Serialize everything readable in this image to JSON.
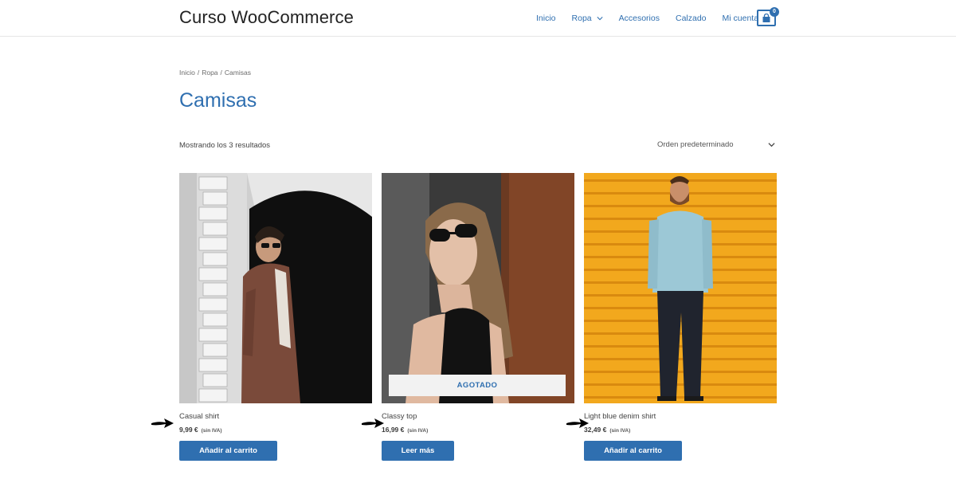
{
  "header": {
    "site_title": "Curso WooCommerce",
    "nav": [
      {
        "label": "Inicio"
      },
      {
        "label": "Ropa",
        "has_dropdown": true
      },
      {
        "label": "Accesorios"
      },
      {
        "label": "Calzado"
      },
      {
        "label": "Mi cuenta"
      }
    ],
    "cart_count": "0",
    "cart_icon": "shopping-bag-icon"
  },
  "breadcrumb": [
    "Inicio",
    "/",
    "Ropa",
    "/",
    "Camisas"
  ],
  "page_title": "Camisas",
  "toolbar": {
    "result_count": "Mostrando los 3 resultados",
    "ordering_selected": "Orden predeterminado"
  },
  "products": [
    {
      "name": "Casual shirt",
      "price": "9,99 €",
      "tax": "(sin IVA)",
      "button": "Añadir al carrito"
    },
    {
      "name": "Classy top",
      "price": "16,99 €",
      "tax": "(sin IVA)",
      "button": "Leer más",
      "badge": "AGOTADO"
    },
    {
      "name": "Light blue denim shirt",
      "price": "32,49 €",
      "tax": "(sin IVA)",
      "button": "Añadir al carrito"
    }
  ],
  "colors": {
    "accent": "#2f6fb0",
    "text": "#3a3a3a",
    "yellow_wall": "#f2a81d"
  }
}
